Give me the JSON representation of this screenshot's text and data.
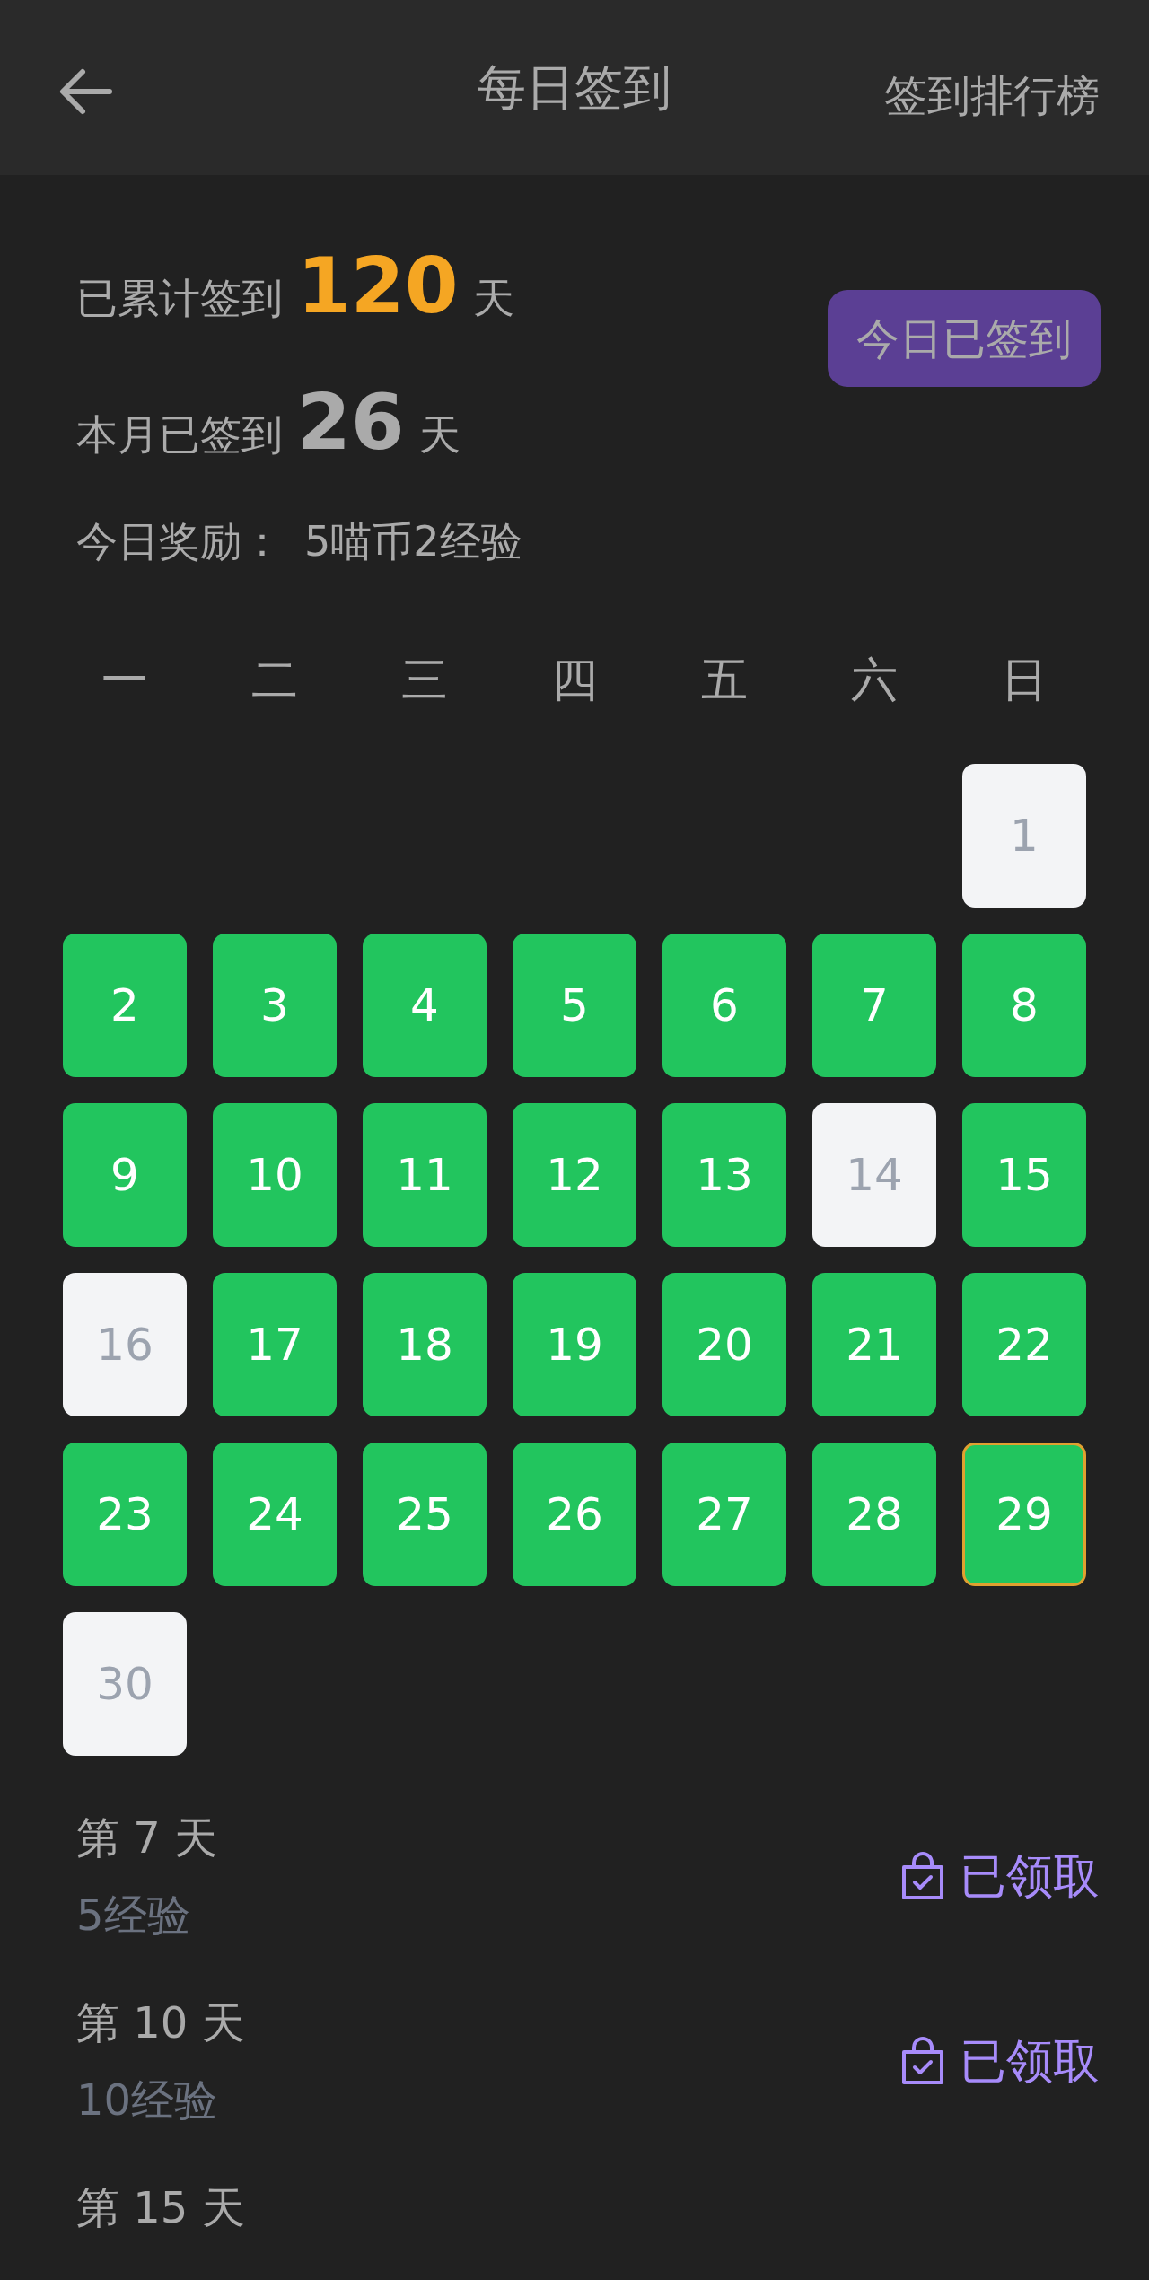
{
  "header": {
    "title": "每日签到",
    "action": "签到排行榜"
  },
  "stats": {
    "total": {
      "label": "已累计签到",
      "value": "120",
      "unit": "天"
    },
    "month": {
      "label": "本月已签到",
      "value": "26",
      "unit": "天"
    },
    "today_reward": {
      "label": "今日奖励：",
      "value": "5喵币2经验"
    },
    "sign_button": {
      "label": "今日已签到",
      "signed": true
    }
  },
  "calendar": {
    "weekdays": [
      "一",
      "二",
      "三",
      "四",
      "五",
      "六",
      "日"
    ],
    "days": [
      {
        "kind": "empty"
      },
      {
        "kind": "empty"
      },
      {
        "kind": "empty"
      },
      {
        "kind": "empty"
      },
      {
        "kind": "empty"
      },
      {
        "kind": "empty"
      },
      {
        "kind": "day",
        "label": "1",
        "signed": false,
        "today": false
      },
      {
        "kind": "day",
        "label": "2",
        "signed": true,
        "today": false
      },
      {
        "kind": "day",
        "label": "3",
        "signed": true,
        "today": false
      },
      {
        "kind": "day",
        "label": "4",
        "signed": true,
        "today": false
      },
      {
        "kind": "day",
        "label": "5",
        "signed": true,
        "today": false
      },
      {
        "kind": "day",
        "label": "6",
        "signed": true,
        "today": false
      },
      {
        "kind": "day",
        "label": "7",
        "signed": true,
        "today": false
      },
      {
        "kind": "day",
        "label": "8",
        "signed": true,
        "today": false
      },
      {
        "kind": "day",
        "label": "9",
        "signed": true,
        "today": false
      },
      {
        "kind": "day",
        "label": "10",
        "signed": true,
        "today": false
      },
      {
        "kind": "day",
        "label": "11",
        "signed": true,
        "today": false
      },
      {
        "kind": "day",
        "label": "12",
        "signed": true,
        "today": false
      },
      {
        "kind": "day",
        "label": "13",
        "signed": true,
        "today": false
      },
      {
        "kind": "day",
        "label": "14",
        "signed": false,
        "today": false
      },
      {
        "kind": "day",
        "label": "15",
        "signed": true,
        "today": false
      },
      {
        "kind": "day",
        "label": "16",
        "signed": false,
        "today": false
      },
      {
        "kind": "day",
        "label": "17",
        "signed": true,
        "today": false
      },
      {
        "kind": "day",
        "label": "18",
        "signed": true,
        "today": false
      },
      {
        "kind": "day",
        "label": "19",
        "signed": true,
        "today": false
      },
      {
        "kind": "day",
        "label": "20",
        "signed": true,
        "today": false
      },
      {
        "kind": "day",
        "label": "21",
        "signed": true,
        "today": false
      },
      {
        "kind": "day",
        "label": "22",
        "signed": true,
        "today": false
      },
      {
        "kind": "day",
        "label": "23",
        "signed": true,
        "today": false
      },
      {
        "kind": "day",
        "label": "24",
        "signed": true,
        "today": false
      },
      {
        "kind": "day",
        "label": "25",
        "signed": true,
        "today": false
      },
      {
        "kind": "day",
        "label": "26",
        "signed": true,
        "today": false
      },
      {
        "kind": "day",
        "label": "27",
        "signed": true,
        "today": false
      },
      {
        "kind": "day",
        "label": "28",
        "signed": true,
        "today": false
      },
      {
        "kind": "day",
        "label": "29",
        "signed": true,
        "today": true
      },
      {
        "kind": "day",
        "label": "30",
        "signed": false,
        "today": false
      }
    ]
  },
  "rewards": [
    {
      "title": "第 7 天",
      "reward": "5经验",
      "status": "已领取",
      "claimed": true
    },
    {
      "title": "第 10 天",
      "reward": "10经验",
      "status": "已领取",
      "claimed": true
    },
    {
      "title": "第 15 天"
    }
  ]
}
